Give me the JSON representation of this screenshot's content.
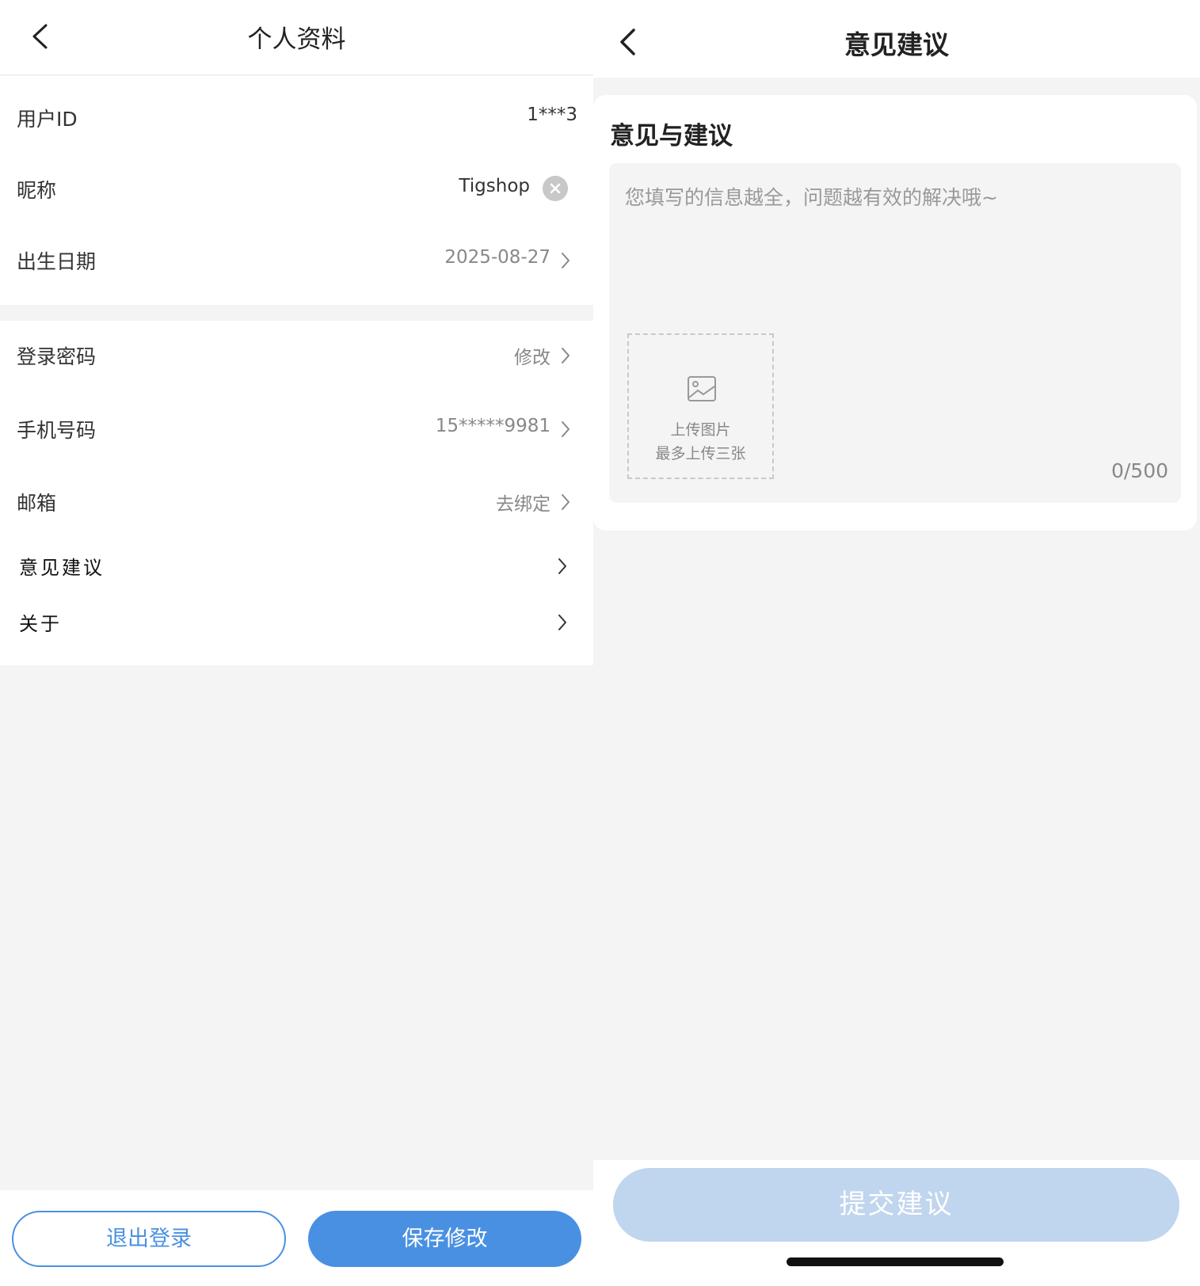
{
  "profile": {
    "title": "个人资料",
    "rows": {
      "user_id": {
        "label": "用户ID",
        "value": "1***3"
      },
      "nickname": {
        "label": "昵称",
        "value": "Tigshop"
      },
      "birthday": {
        "label": "出生日期",
        "value": "2025-08-27"
      },
      "password": {
        "label": "登录密码",
        "value": "修改"
      },
      "phone": {
        "label": "手机号码",
        "value": "15*****9981"
      },
      "email": {
        "label": "邮箱",
        "value": "去绑定"
      },
      "feedback": {
        "label": "意见建议"
      },
      "about": {
        "label": "关于"
      }
    },
    "logout_label": "退出登录",
    "save_label": "保存修改",
    "colors": {
      "accent": "#4a90e2",
      "background": "#f4f4f4"
    }
  },
  "feedback": {
    "title": "意见建议",
    "section_title": "意见与建议",
    "placeholder": "您填写的信息越全，问题越有效的解决哦~",
    "upload_label": "上传图片",
    "upload_hint": "最多上传三张",
    "counter": "0/500",
    "submit_label": "提交建议",
    "colors": {
      "submit_disabled": "#c0d5ee"
    }
  }
}
